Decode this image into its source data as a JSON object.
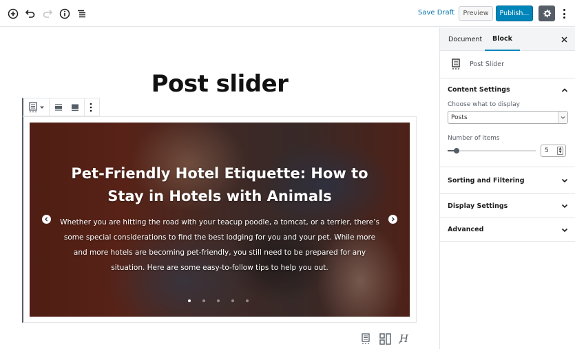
{
  "topbar": {
    "icons": [
      "add-block-icon",
      "undo-icon",
      "redo-icon",
      "info-icon",
      "outline-icon"
    ],
    "save_draft": "Save Draft",
    "preview": "Preview",
    "publish": "Publish...",
    "settings_icon": "gear-icon",
    "more_icon": "kebab-icon",
    "accent": "#0085ba"
  },
  "editor": {
    "post_title": "Post slider",
    "block_toolbar": {
      "buttons": [
        "block-type-icon",
        "align-wide-icon",
        "align-full-icon",
        "more-options-icon"
      ]
    },
    "slider": {
      "slide_title": "Pet-Friendly Hotel Etiquette: How to Stay in Hotels with Animals",
      "slide_excerpt": "Whether you are hitting the road with your teacup poodle, a tomcat, or a terrier, there’s some special considerations to find the best lodging for you and your pet. While more and more hotels are becoming pet-friendly, you still need to be prepared for any situation. Here are some easy-to-follow tips to help you out.",
      "total_slides": 5,
      "active_slide": 1
    },
    "layout_options": [
      "list-layout-icon",
      "grid-layout-icon",
      "typography-icon"
    ]
  },
  "sidebar": {
    "tabs": [
      {
        "label": "Document",
        "active": false
      },
      {
        "label": "Block",
        "active": true
      }
    ],
    "block_name": "Post Slider",
    "panels": {
      "content_settings": {
        "title": "Content Settings",
        "expanded": true,
        "choose_label": "Choose what to display",
        "choose_value": "Posts",
        "items_label": "Number of items",
        "items_value": "5",
        "items_slider_fraction": 0.1
      },
      "sorting": {
        "title": "Sorting and Filtering",
        "expanded": false
      },
      "display": {
        "title": "Display Settings",
        "expanded": false
      },
      "advanced": {
        "title": "Advanced",
        "expanded": false
      }
    }
  }
}
